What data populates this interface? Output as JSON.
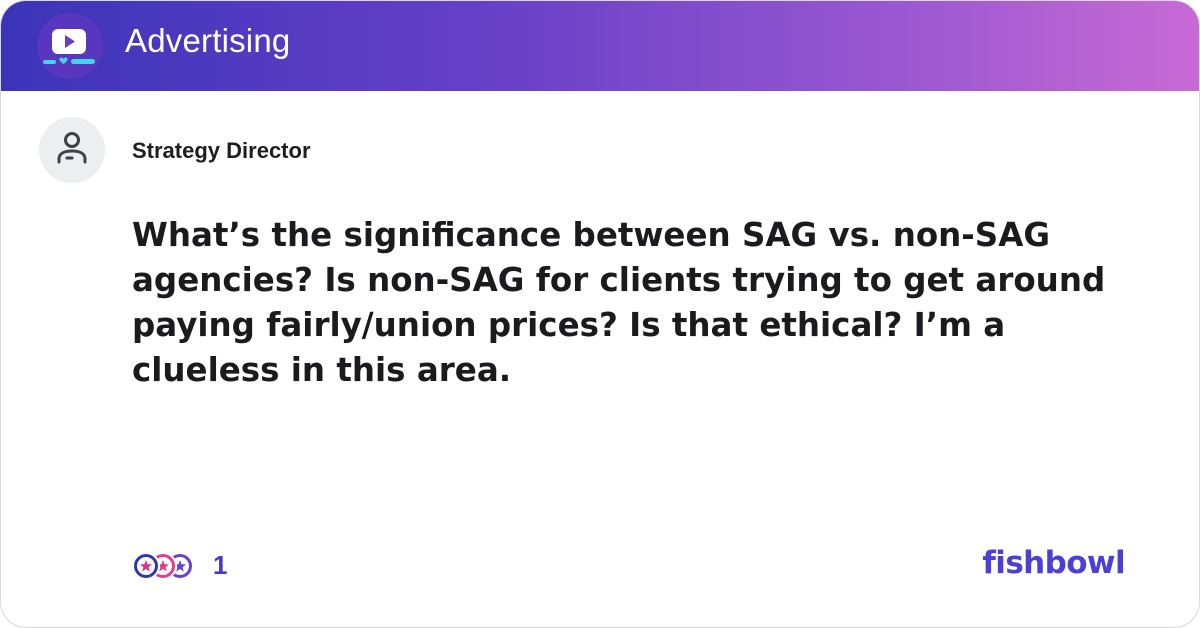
{
  "header": {
    "bowl_title": "Advertising",
    "icon": "video-chat-bowl-icon"
  },
  "post": {
    "author_title": "Strategy Director",
    "avatar_icon": "user-icon",
    "text": "What’s the significance between SAG vs. non-SAG agencies? Is non-SAG for clients trying to get around paying fairly/union prices? Is that ethical? I’m a clueless in this area."
  },
  "footer": {
    "reaction_icons": [
      "star-icon",
      "star-icon",
      "star-icon"
    ],
    "reaction_count": "1",
    "brand": "fishbowl"
  },
  "colors": {
    "header_gradient_start": "#3b34b8",
    "header_gradient_end": "#c86ad6",
    "brand_color": "#4a3fd6",
    "count_color": "#4a36c8"
  }
}
